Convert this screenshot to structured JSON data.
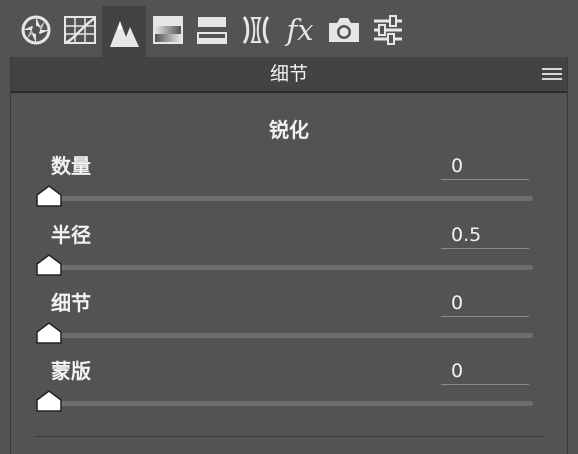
{
  "toolbar": {
    "tools": [
      {
        "name": "basic-aperture-icon",
        "active": false
      },
      {
        "name": "tone-curve-icon",
        "active": false
      },
      {
        "name": "detail-mountains-icon",
        "active": true
      },
      {
        "name": "hsl-gradient-icon",
        "active": false
      },
      {
        "name": "split-toning-icon",
        "active": false
      },
      {
        "name": "lens-corrections-icon",
        "active": false
      },
      {
        "name": "fx-effects-icon",
        "label": "fx",
        "active": false
      },
      {
        "name": "camera-calibration-icon",
        "active": false
      },
      {
        "name": "presets-sliders-icon",
        "active": false
      }
    ]
  },
  "panel": {
    "title": "细节",
    "menu_icon": "hamburger-menu-icon"
  },
  "section": {
    "title": "锐化",
    "sliders": [
      {
        "label": "数量",
        "value": "0",
        "position": 0
      },
      {
        "label": "半径",
        "value": "0.5",
        "position": 0
      },
      {
        "label": "细节",
        "value": "0",
        "position": 0
      },
      {
        "label": "蒙版",
        "value": "0",
        "position": 0
      }
    ]
  },
  "colors": {
    "panel_bg": "#535353",
    "header_bg": "#434343",
    "track": "#6e6e6e",
    "text": "#f2f2f2"
  }
}
